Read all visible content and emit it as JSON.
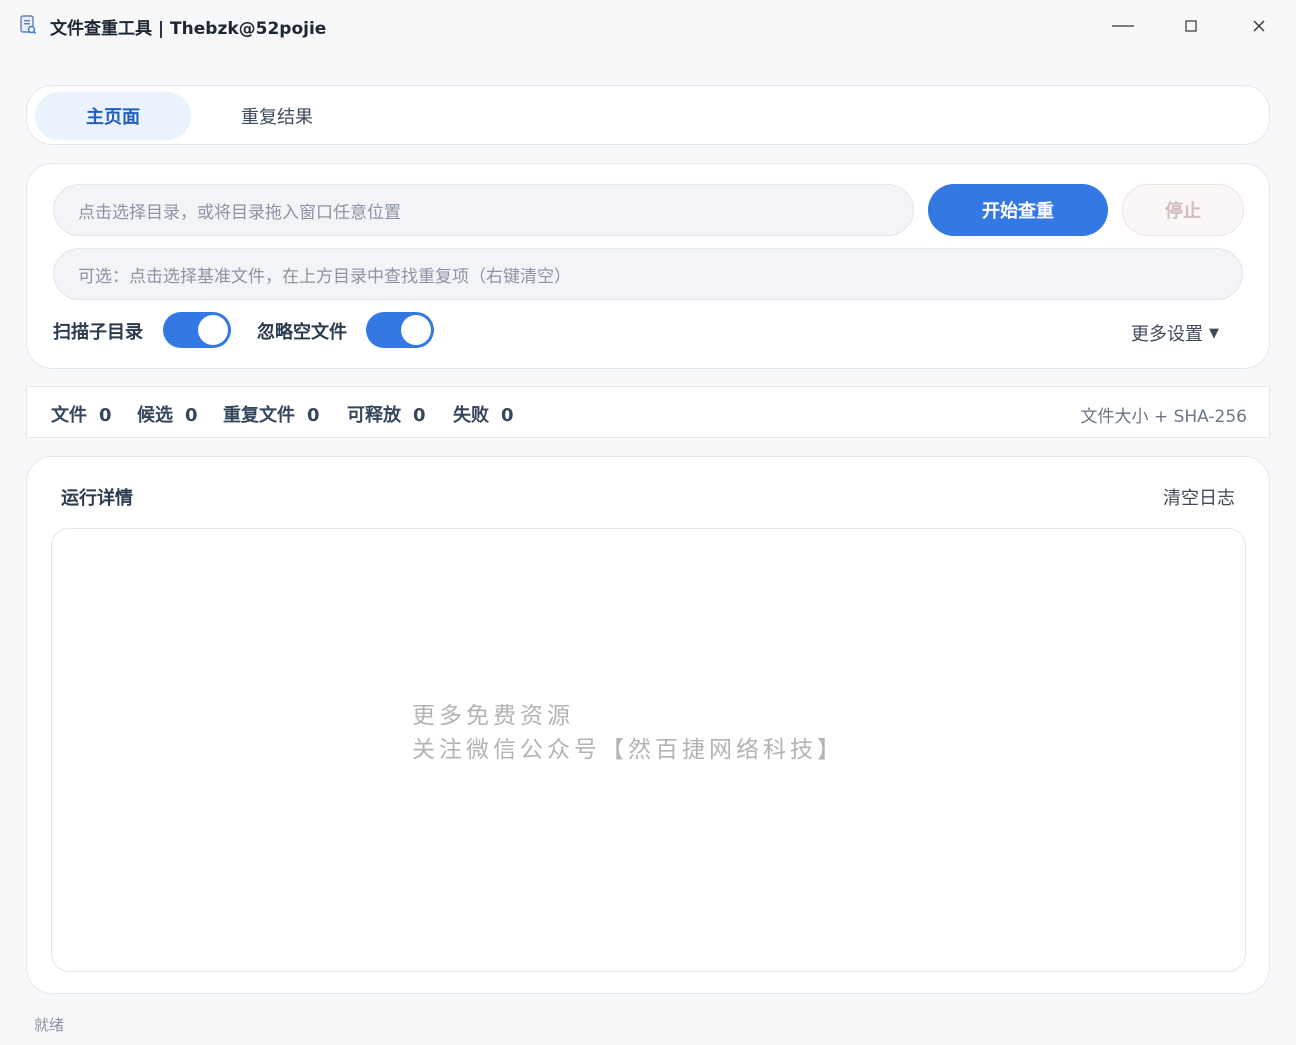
{
  "window": {
    "title": "文件查重工具 | Thebzk@52pojie",
    "icon": "document-app-icon",
    "controls": {
      "minimize": "—",
      "maximize": "□",
      "close": "✕"
    }
  },
  "tabs": [
    {
      "label": "主页面",
      "active": true
    },
    {
      "label": "重复结果",
      "active": false
    }
  ],
  "scan": {
    "dir_placeholder": "点击选择目录，或将目录拖入窗口任意位置",
    "base_placeholder": "可选：点击选择基准文件，在上方目录中查找重复项（右键清空）",
    "start_label": "开始查重",
    "stop_label": "停止",
    "options": [
      {
        "label": "扫描子目录",
        "on": true
      },
      {
        "label": "忽略空文件",
        "on": true
      }
    ],
    "more_label": "更多设置",
    "more_caret": "▼"
  },
  "stats": {
    "items": [
      {
        "label": "文件",
        "value": "0"
      },
      {
        "label": "候选",
        "value": "0"
      },
      {
        "label": "重复文件",
        "value": "0"
      },
      {
        "label": "可释放",
        "value": "0"
      },
      {
        "label": "失败",
        "value": "0"
      }
    ],
    "algorithm": "文件大小 + SHA-256"
  },
  "log": {
    "title": "运行详情",
    "clear_label": "清空日志",
    "watermark_line1": "更多免费资源",
    "watermark_line2": "关注微信公众号【然百捷网络科技】"
  },
  "status": "就绪",
  "colors": {
    "accent": "#3478e4",
    "tab_active_bg": "#eaf2fd",
    "tab_active_text": "#1f5fbf"
  }
}
